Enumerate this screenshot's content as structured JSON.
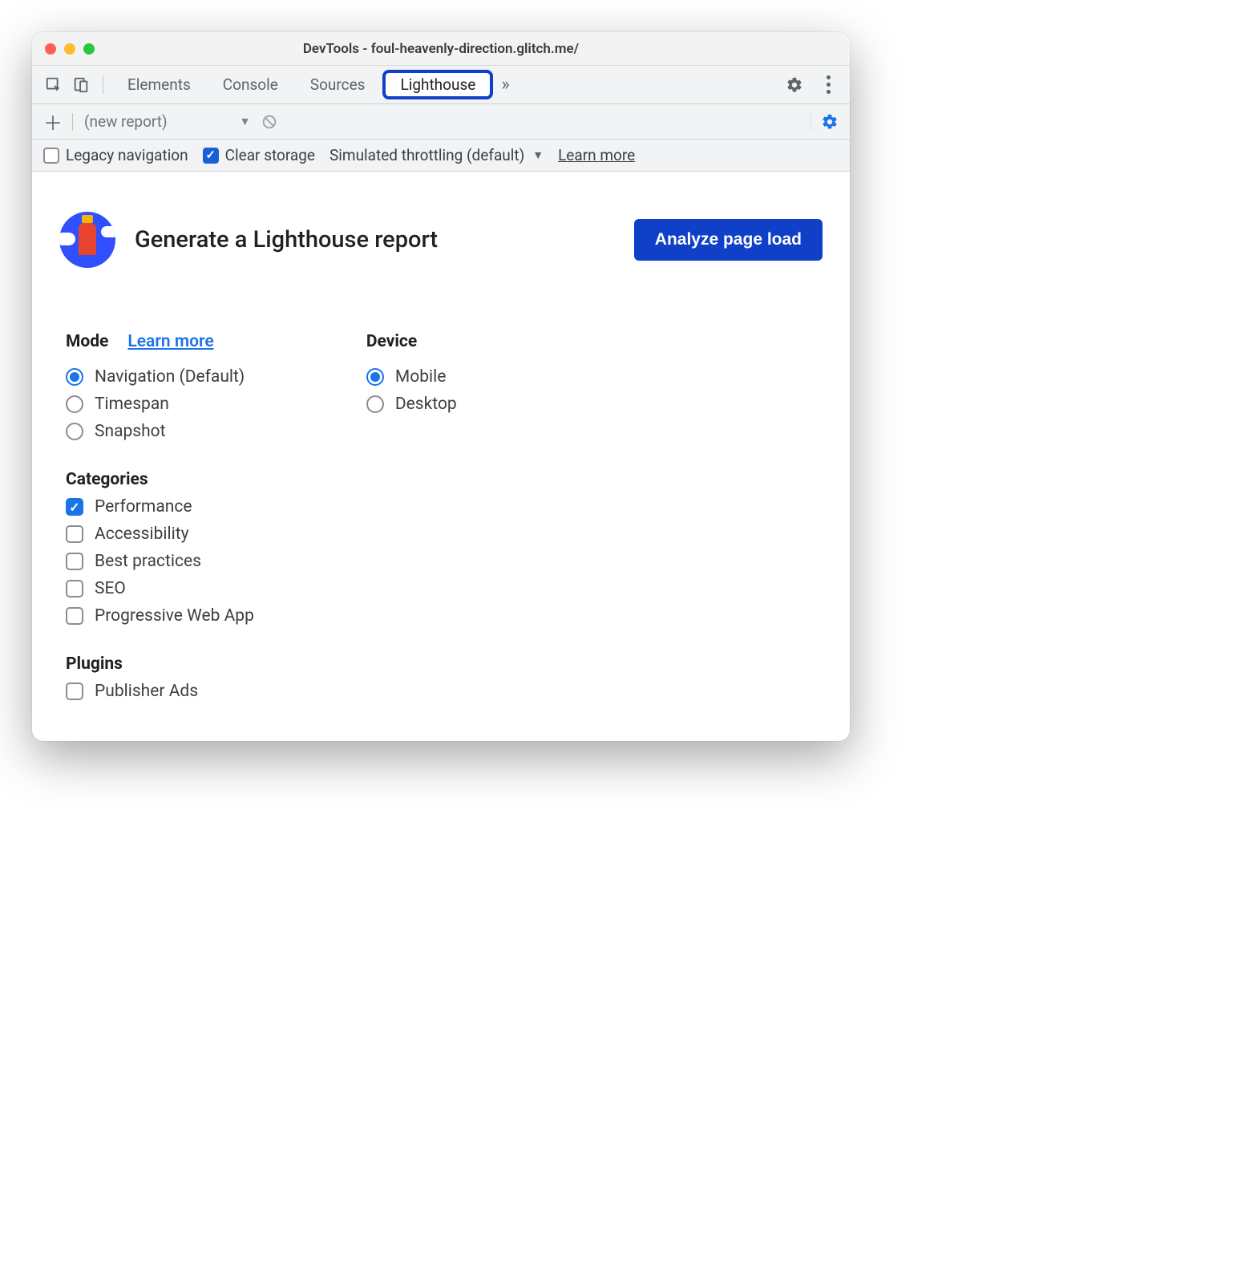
{
  "window": {
    "title": "DevTools - foul-heavenly-direction.glitch.me/"
  },
  "tabs": {
    "items": [
      "Elements",
      "Console",
      "Sources",
      "Lighthouse"
    ],
    "active_index": 3
  },
  "toolbar": {
    "report_placeholder": "(new report)"
  },
  "options_strip": {
    "legacy_label": "Legacy navigation",
    "legacy_checked": false,
    "clear_label": "Clear storage",
    "clear_checked": true,
    "throttling_label": "Simulated throttling (default)",
    "learn_more": "Learn more"
  },
  "hero": {
    "title": "Generate a Lighthouse report",
    "analyze_label": "Analyze page load"
  },
  "mode": {
    "title": "Mode",
    "learn_more": "Learn more",
    "options": [
      {
        "label": "Navigation (Default)",
        "selected": true
      },
      {
        "label": "Timespan",
        "selected": false
      },
      {
        "label": "Snapshot",
        "selected": false
      }
    ]
  },
  "device": {
    "title": "Device",
    "options": [
      {
        "label": "Mobile",
        "selected": true
      },
      {
        "label": "Desktop",
        "selected": false
      }
    ]
  },
  "categories": {
    "title": "Categories",
    "options": [
      {
        "label": "Performance",
        "checked": true
      },
      {
        "label": "Accessibility",
        "checked": false
      },
      {
        "label": "Best practices",
        "checked": false
      },
      {
        "label": "SEO",
        "checked": false
      },
      {
        "label": "Progressive Web App",
        "checked": false
      }
    ]
  },
  "plugins": {
    "title": "Plugins",
    "options": [
      {
        "label": "Publisher Ads",
        "checked": false
      }
    ]
  }
}
